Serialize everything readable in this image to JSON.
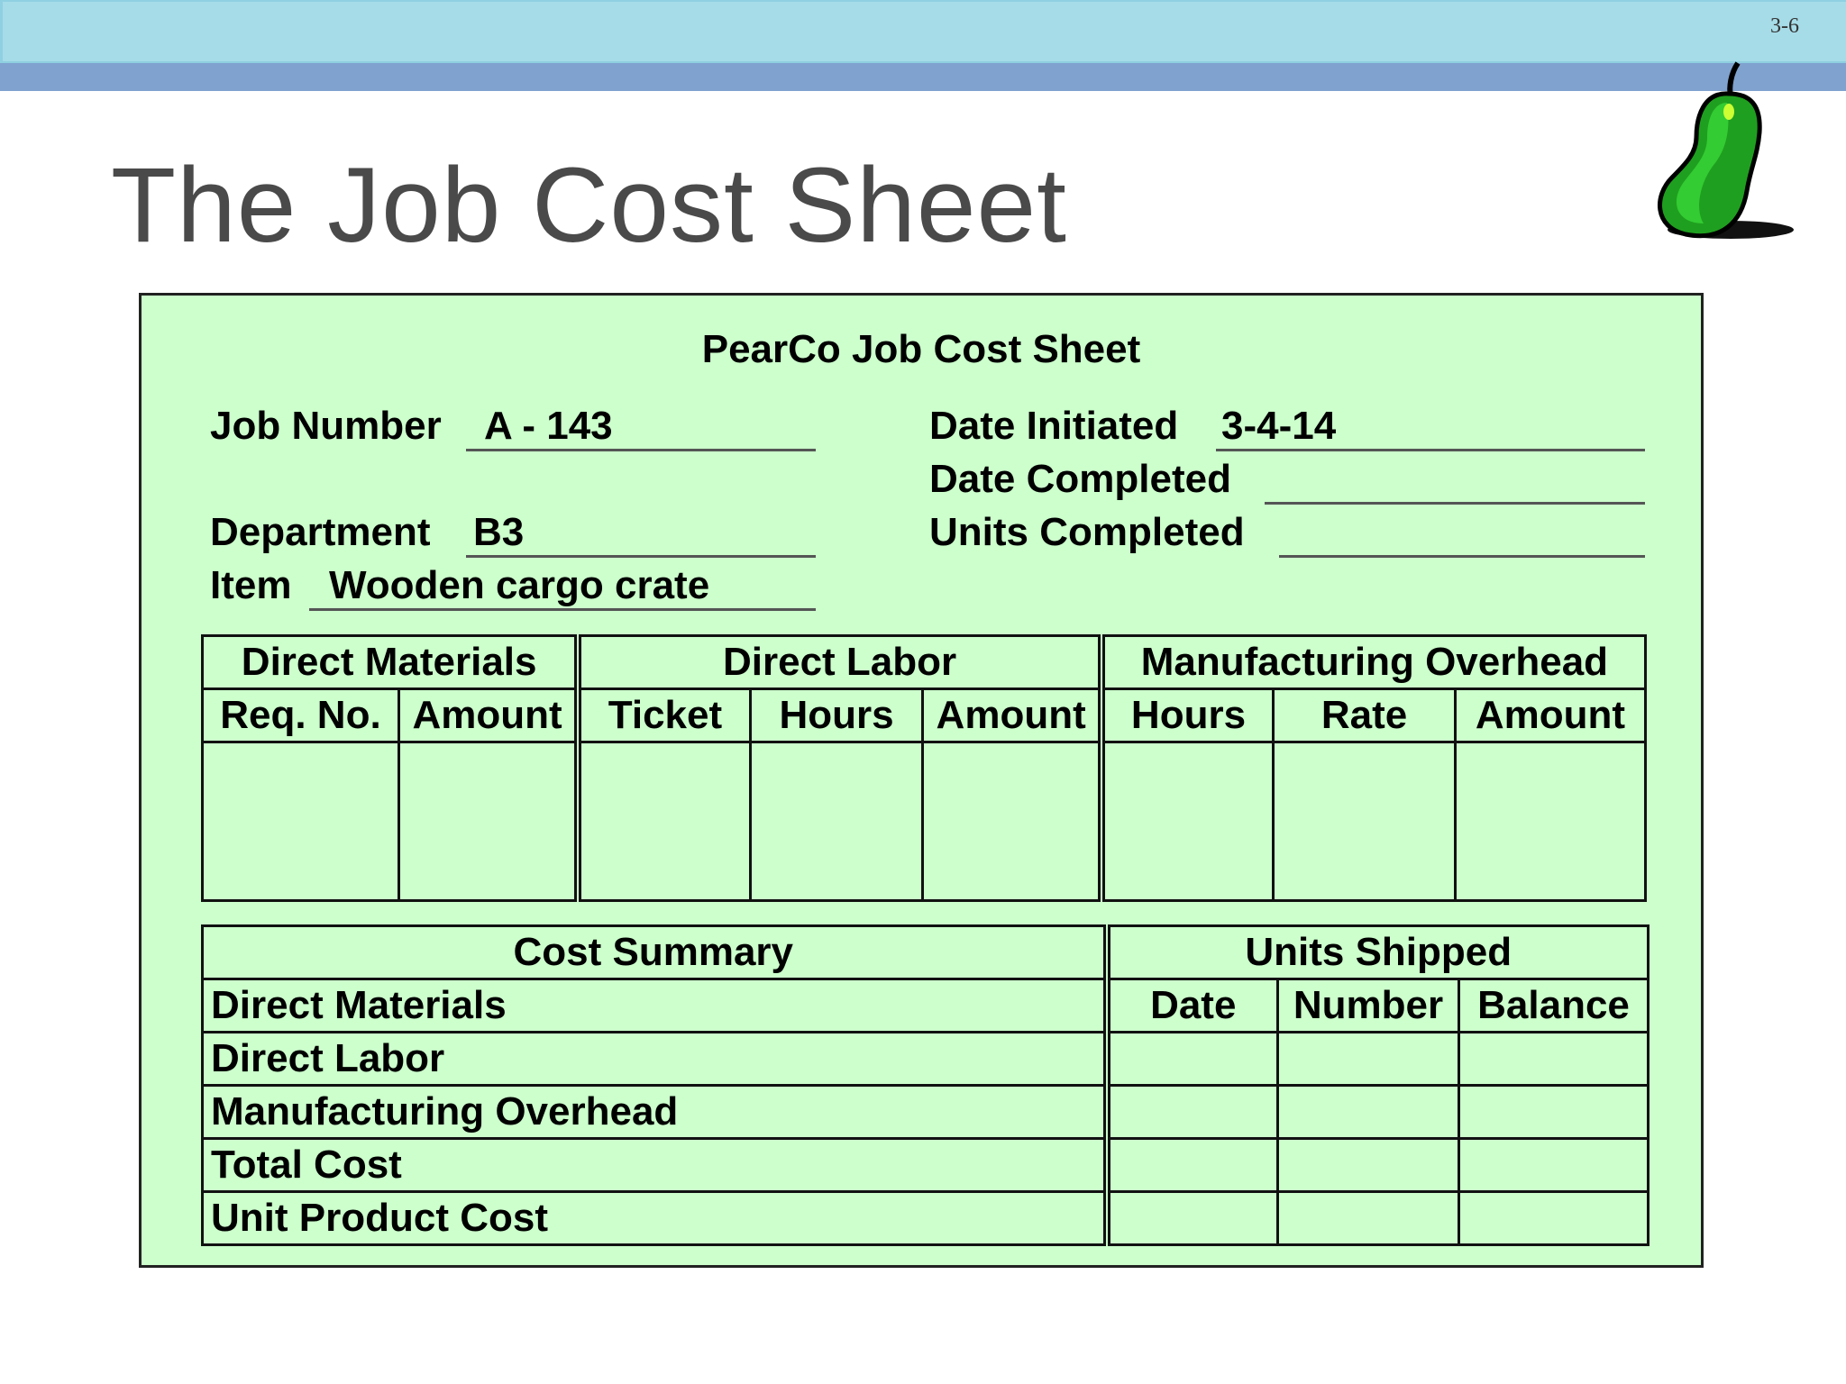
{
  "slide": {
    "number": "3-6",
    "title": "The Job Cost Sheet"
  },
  "sheet": {
    "title": "PearCo Job Cost Sheet",
    "job_number": {
      "label": "Job Number",
      "value": "A - 143"
    },
    "department": {
      "label": "Department",
      "value": "B3"
    },
    "item": {
      "label": "Item",
      "value": "Wooden cargo crate"
    },
    "date_initiated": {
      "label": "Date Initiated",
      "value": "3-4-14"
    },
    "date_completed": {
      "label": "Date Completed",
      "value": ""
    },
    "units_completed": {
      "label": "Units Completed",
      "value": ""
    }
  },
  "cost_table": {
    "groups": [
      "Direct Materials",
      "Direct Labor",
      "Manufacturing Overhead"
    ],
    "columns": [
      "Req. No.",
      "Amount",
      "Ticket",
      "Hours",
      "Amount",
      "Hours",
      "Rate",
      "Amount"
    ]
  },
  "summary": {
    "title": "Cost Summary",
    "rows": [
      "Direct Materials",
      "Direct Labor",
      "Manufacturing Overhead",
      "Total Cost",
      "Unit Product Cost"
    ]
  },
  "shipped": {
    "title": "Units Shipped",
    "columns": [
      "Date",
      "Number",
      "Balance"
    ]
  },
  "colors": {
    "sheet_background": "#ccffcc",
    "top_bar": "#a6dce8",
    "accent_bar": "#7fa2cf",
    "pear": "#22bb22"
  }
}
